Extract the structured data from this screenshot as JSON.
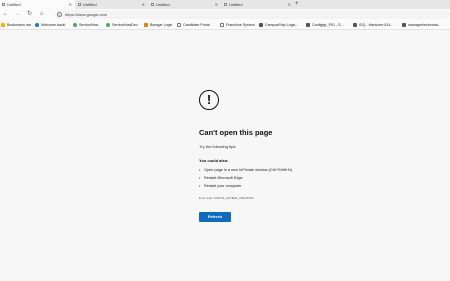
{
  "tabs": [
    {
      "label": "Untitled",
      "active": true
    },
    {
      "label": "Untitled",
      "active": false
    },
    {
      "label": "Untitled",
      "active": false
    },
    {
      "label": "Untitled",
      "active": false
    }
  ],
  "toolbar": {
    "back_icon": "back-arrow-icon",
    "forward_icon": "forward-arrow-icon",
    "refresh_icon": "refresh-icon",
    "home_icon": "home-icon",
    "url": "https://www.google.com"
  },
  "bookmarks": [
    {
      "label": "Bookmarks bar",
      "color": "#f4b400"
    },
    {
      "label": "Welcome back!",
      "color": "#1a73e8"
    },
    {
      "label": "ServiceNow",
      "color": "#4caf50"
    },
    {
      "label": "ServiceNowDev",
      "color": "#4caf50"
    },
    {
      "label": "Bomgar Login",
      "color": "#f57c00"
    },
    {
      "label": "Candidate Portal",
      "color": "#777777"
    },
    {
      "label": "Franchise System",
      "color": "#777777"
    },
    {
      "label": "CampusShip Login...",
      "color": "#6d4c41"
    },
    {
      "label": "Configfgr_P01 - S...",
      "color": "#555555"
    },
    {
      "label": "IDQ - Hardcore 814...",
      "color": "#555555"
    },
    {
      "label": "manageelectronics...",
      "color": "#555555"
    }
  ],
  "error": {
    "icon": "exclamation-icon",
    "heading": "Can't open this page",
    "subtitle": "Try the following tips:",
    "could_also": "You could also:",
    "tips": [
      "Open page in a new InPrivate window (Ctrl+Shift+N)",
      "Restart Microsoft Edge",
      "Restart your computer"
    ],
    "error_code": "Error code: STATUS_ACCESS_VIOLATION",
    "refresh_label": "Refresh",
    "accent": "#0f6cbd"
  }
}
